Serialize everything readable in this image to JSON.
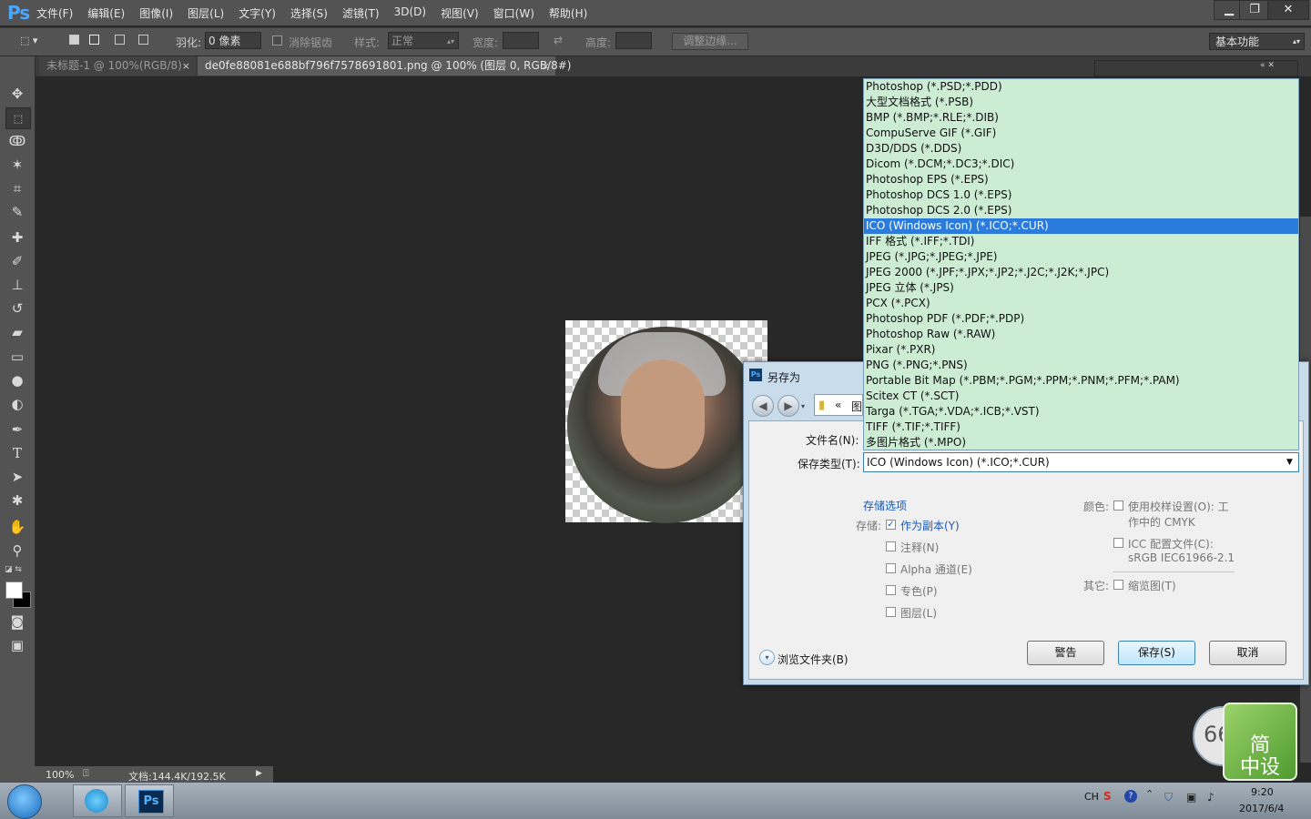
{
  "app": {
    "logo": "Ps"
  },
  "menu": [
    "文件(F)",
    "编辑(E)",
    "图像(I)",
    "图层(L)",
    "文字(Y)",
    "选择(S)",
    "滤镜(T)",
    "3D(D)",
    "视图(V)",
    "窗口(W)",
    "帮助(H)"
  ],
  "window_controls": {
    "minimize": "▁",
    "restore": "❐",
    "close": "✕"
  },
  "options": {
    "feather_label": "羽化:",
    "feather_value": "0 像素",
    "antialias_label": "消除锯齿",
    "style_label": "样式:",
    "style_value": "正常",
    "width_label": "宽度:",
    "height_label": "高度:",
    "refine_edge": "调整边缘...",
    "workspace": "基本功能"
  },
  "tabs": [
    {
      "label": "未标题-1 @ 100%(RGB/8)",
      "close": "×"
    },
    {
      "label": "de0fe88081e688bf796f7578691801.png @ 100% (图层 0, RGB/8#)",
      "close": "×"
    }
  ],
  "status": {
    "zoom": "100%",
    "doc": "文档:144.4K/192.5K"
  },
  "dialog": {
    "title": "另存为",
    "path_prefix": "«",
    "path_text": "图",
    "filename_label": "文件名(N):",
    "savetype_label": "保存类型(T):",
    "savetype_value": "ICO (Windows Icon) (*.ICO;*.CUR)",
    "storage_options": "存储选项",
    "save_label": "存储:",
    "as_copy": "作为副本(Y)",
    "notes": "注释(N)",
    "alpha": "Alpha 通道(E)",
    "spot": "专色(P)",
    "layers": "图层(L)",
    "color_label": "颜色:",
    "use_proof": "使用校样设置(O): 工",
    "use_proof_sub": "作中的 CMYK",
    "icc": "ICC 配置文件(C):",
    "icc_sub": "sRGB IEC61966-2.1",
    "other_label": "其它:",
    "thumbnail": "缩览图(T)",
    "browse": "浏览文件夹(B)",
    "btn_warn": "警告",
    "btn_save": "保存(S)",
    "btn_cancel": "取消"
  },
  "dropdown_options": [
    "Photoshop (*.PSD;*.PDD)",
    "大型文档格式 (*.PSB)",
    "BMP (*.BMP;*.RLE;*.DIB)",
    "CompuServe GIF (*.GIF)",
    "D3D/DDS (*.DDS)",
    "Dicom (*.DCM;*.DC3;*.DIC)",
    "Photoshop EPS (*.EPS)",
    "Photoshop DCS 1.0 (*.EPS)",
    "Photoshop DCS 2.0 (*.EPS)",
    "ICO (Windows Icon) (*.ICO;*.CUR)",
    "IFF 格式 (*.IFF;*.TDI)",
    "JPEG (*.JPG;*.JPEG;*.JPE)",
    "JPEG 2000 (*.JPF;*.JPX;*.JP2;*.J2C;*.J2K;*.JPC)",
    "JPEG 立体 (*.JPS)",
    "PCX (*.PCX)",
    "Photoshop PDF (*.PDF;*.PDP)",
    "Photoshop Raw (*.RAW)",
    "Pixar (*.PXR)",
    "PNG (*.PNG;*.PNS)",
    "Portable Bit Map (*.PBM;*.PGM;*.PPM;*.PNM;*.PFM;*.PAM)",
    "Scitex CT (*.SCT)",
    "Targa (*.TGA;*.VDA;*.ICB;*.VST)",
    "TIFF (*.TIF;*.TIFF)",
    "多图片格式 (*.MPO)"
  ],
  "dropdown_selected_index": 9,
  "taskbar": {
    "lang": "CH",
    "time": "9:20",
    "date": "2017/6/4",
    "ps_icon": "Ps"
  },
  "widget": {
    "text1": "简",
    "text2": "中设",
    "clock": "66"
  }
}
